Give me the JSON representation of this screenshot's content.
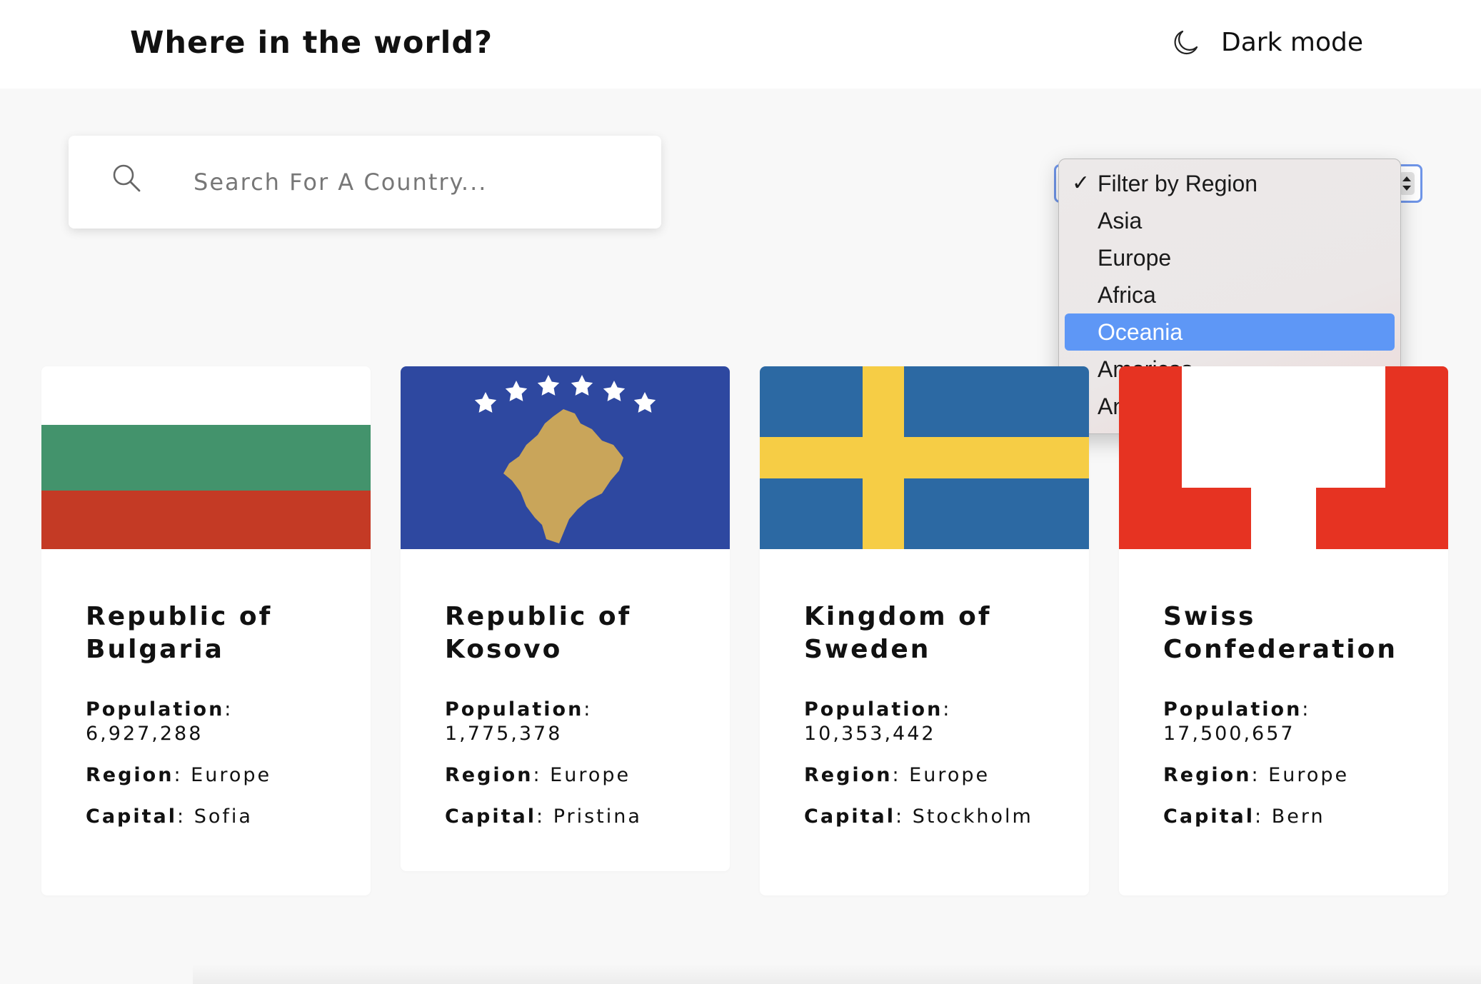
{
  "header": {
    "title": "Where in the world?",
    "dark_mode_label": "Dark mode",
    "dark_mode_icon": "moon-icon"
  },
  "search": {
    "placeholder": "Search For A Country...",
    "value": "",
    "icon": "search-icon"
  },
  "filter": {
    "selected": "Filter by Region",
    "highlighted": "Oceania",
    "options": [
      "Filter by Region",
      "Asia",
      "Europe",
      "Africa",
      "Oceania",
      "Americas",
      "Antarctic"
    ]
  },
  "labels": {
    "population": "Population",
    "region": "Region",
    "capital": "Capital"
  },
  "countries": [
    {
      "name": "Republic of Bulgaria",
      "population": "6,927,288",
      "region": "Europe",
      "capital": "Sofia",
      "flag_colors": [
        "#ffffff",
        "#43936c",
        "#c43a25"
      ]
    },
    {
      "name": "Republic of Kosovo",
      "population": "1,775,378",
      "region": "Europe",
      "capital": "Pristina",
      "flag_colors": [
        "#2e48a0",
        "#c9a55a",
        "#ffffff"
      ]
    },
    {
      "name": "Kingdom of Sweden",
      "population": "10,353,442",
      "region": "Europe",
      "capital": "Stockholm",
      "flag_colors": [
        "#2c69a3",
        "#f6cd45"
      ]
    },
    {
      "name": "Swiss Confederation",
      "population": "17,500,657",
      "region": "Europe",
      "capital": "Bern",
      "flag_colors": [
        "#e63322",
        "#ffffff"
      ]
    }
  ]
}
